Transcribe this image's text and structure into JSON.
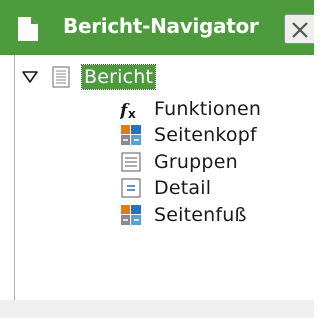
{
  "window": {
    "title": "Bericht-Navigator",
    "doc_icon": "document-icon",
    "close_icon": "close-icon"
  },
  "tree": {
    "root": {
      "label": "Bericht",
      "icon": "report-icon",
      "expanded": true
    },
    "children": [
      {
        "label": "Funktionen",
        "icon": "function-icon"
      },
      {
        "label": "Seitenkopf",
        "icon": "page-header-icon"
      },
      {
        "label": "Gruppen",
        "icon": "groups-icon"
      },
      {
        "label": "Detail",
        "icon": "detail-icon"
      },
      {
        "label": "Seitenfuß",
        "icon": "page-footer-icon"
      }
    ]
  },
  "colors": {
    "accent": "#4d9b3c",
    "selection_text": "#ffffff"
  }
}
